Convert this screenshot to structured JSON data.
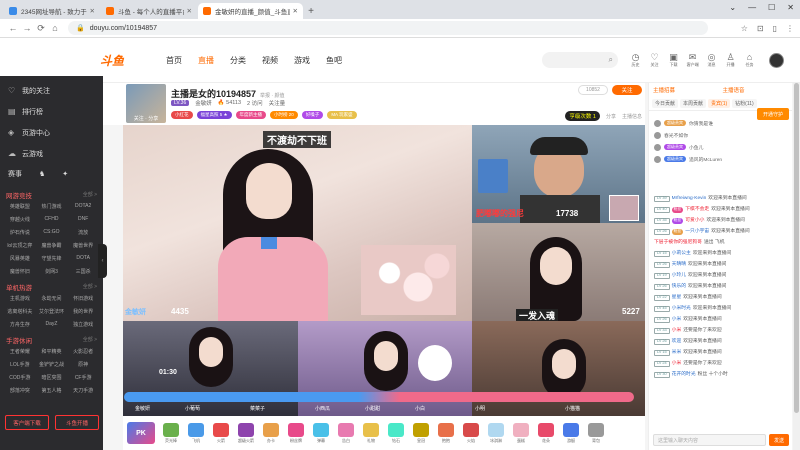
{
  "browser": {
    "tabs": [
      {
        "title": "2345网址导航 - 致力于打造百年品牌",
        "color": "#3a8be8"
      },
      {
        "title": "斗鱼 - 每个人的直播平台",
        "color": "#ff6a00"
      },
      {
        "title": "金敏妍的直播_颜值_斗鱼直播",
        "color": "#ff6a00"
      }
    ],
    "url": "douyu.com/10194857",
    "nav_back": "←",
    "nav_forward": "→",
    "nav_reload": "⟳",
    "nav_home": "⌂",
    "new_tab": "+",
    "window_controls": [
      "⌄",
      "—",
      "☐",
      "✕"
    ],
    "right_icons": [
      "☆",
      "⊡",
      "▯",
      "⋮"
    ]
  },
  "topnav": {
    "logo": "斗鱼",
    "items": [
      "首页",
      "直播",
      "分类",
      "视频",
      "游戏",
      "鱼吧"
    ],
    "active": "直播",
    "search_icon": "⌕",
    "icons": [
      {
        "glyph": "◷",
        "label": "历史"
      },
      {
        "glyph": "♡",
        "label": "关注"
      },
      {
        "glyph": "▣",
        "label": "下载"
      },
      {
        "glyph": "✉",
        "label": "客户端"
      },
      {
        "glyph": "◎",
        "label": "消息"
      },
      {
        "glyph": "♙",
        "label": "开播"
      },
      {
        "glyph": "⌂",
        "label": "任务"
      }
    ]
  },
  "sidebar": {
    "items": [
      {
        "icon": "♡",
        "label": "我的关注"
      },
      {
        "icon": "▤",
        "label": "排行榜"
      },
      {
        "icon": "◈",
        "label": "页游中心"
      },
      {
        "icon": "☁",
        "label": "云游戏"
      }
    ],
    "row3": [
      "赛事",
      "",
      ""
    ],
    "sections": [
      {
        "title": "网游竞技",
        "more": "全部 >",
        "games": [
          "英雄联盟",
          "热门游戏",
          "DOTA2",
          "穿越火线",
          "CFHD",
          "DNF",
          "炉石传说",
          "CS:GO",
          "流放",
          "lol云顶之弈",
          "魔兽争霸",
          "魔兽世界",
          "风暴英雄",
          "守望先锋",
          "DOTA",
          "魔兽怀旧",
          "剑网3",
          "三国杀"
        ]
      },
      {
        "title": "单机热游",
        "more": "全部 >",
        "games": [
          "主机游戏",
          "永劫无间",
          "怀旧游戏",
          "逃离塔科夫",
          "艾尔登法环",
          "我的世界",
          "方舟生存",
          "DayZ",
          "独立游戏"
        ]
      },
      {
        "title": "手游休闲",
        "more": "全部 >",
        "games": [
          "王者荣耀",
          "和平精英",
          "火影忍者",
          "LOL手游",
          "金铲铲之战",
          "原神",
          "COD手游",
          "暗区突围",
          "CF手游",
          "部落冲突",
          "第五人格",
          "天刀手游"
        ]
      }
    ],
    "bottom": [
      "客户端下载",
      "斗鱼开播"
    ],
    "collapse": "‹"
  },
  "room": {
    "avatar_caption": "关注 · 分享",
    "title": "主播是女的10194857",
    "title_note": "举报 · 颜值",
    "level": "LV.36",
    "anchor": "金敏妍",
    "meta": [
      "🔥 54113",
      "2 访问",
      "关注量"
    ],
    "tags": [
      {
        "label": "小红花",
        "color": "#e84a4a"
      },
      {
        "label": "福星高照 5 ★",
        "color": "#7a42d8"
      },
      {
        "label": "年度新主播",
        "color": "#e84a8a"
      },
      {
        "label": "小时榜 20",
        "color": "#ff8a00"
      },
      {
        "label": "好嗓子",
        "color": "#b04ae8"
      },
      {
        "label": "MA 玩家盛",
        "color": "#e8c04a"
      }
    ],
    "report": "10852",
    "follow": "关注",
    "hot": "亨级次数 1",
    "share": "分享",
    "guard": "主播信息"
  },
  "video": {
    "banner": "不渡劫不下班",
    "score_left": "4435",
    "score_right_a": "17738",
    "score_right_b": "5227",
    "caption_b": "一发入魂",
    "nick_left": "金敏妍",
    "nick_right": "肥嘟嘟的强尼",
    "timer": "01:30",
    "bottom_names": [
      "金敏妍",
      "小葡萄",
      "菜菜子",
      "小西瓜",
      "小甜甜",
      "小白",
      "小明",
      "小猫猫"
    ]
  },
  "gifts": {
    "pk": "PK",
    "items": [
      {
        "label": "荧光棒",
        "color": "#6ab04c"
      },
      {
        "label": "飞机",
        "color": "#4a9ae8"
      },
      {
        "label": "火箭",
        "color": "#e84a4a"
      },
      {
        "label": "超级火箭",
        "color": "#8e44ad"
      },
      {
        "label": "办卡",
        "color": "#e8a04a"
      },
      {
        "label": "粉丝牌",
        "color": "#e84a8a"
      },
      {
        "label": "弹幕",
        "color": "#4ac0e8"
      },
      {
        "label": "告白",
        "color": "#e87ab0"
      },
      {
        "label": "礼物",
        "color": "#e8c04a"
      },
      {
        "label": "钻石",
        "color": "#4ae8c8"
      },
      {
        "label": "皇冠",
        "color": "#c0a000"
      },
      {
        "label": "抱抱",
        "color": "#e8704a"
      },
      {
        "label": "火焰",
        "color": "#d84a4a"
      },
      {
        "label": "冰淇淋",
        "color": "#b0d8f0"
      },
      {
        "label": "蛋糕",
        "color": "#f0b0c0"
      },
      {
        "label": "花朵",
        "color": "#e84a6a"
      },
      {
        "label": "游艇",
        "color": "#4a7ae8"
      },
      {
        "label": "背包",
        "color": "#999999"
      }
    ]
  },
  "rightpanel": {
    "top": [
      "主播招募",
      "主播语音"
    ],
    "tabs": [
      "今日贡献",
      "本周贡献",
      "贵宾(1)",
      "钻粉(11)"
    ],
    "active_tab": "贵宾(1)",
    "open_guard": "开通守护",
    "ranks": [
      {
        "badge": "超级贵宾",
        "color": "#e8a04a",
        "name": "你猜我是谁"
      },
      {
        "badge": "",
        "color": "#e84a4a",
        "name": "春光不如你"
      },
      {
        "badge": "超级贵宾",
        "color": "#b04ae8",
        "name": "小鱼儿"
      },
      {
        "badge": "超级贵宾",
        "color": "#4a7ae8",
        "name": "追风的McLuren"
      }
    ],
    "chat": [
      {
        "lv": "LV 39",
        "badge": "",
        "badge_color": "#e8a04a",
        "name": "Mrfreiwng·Kevin",
        "red": false,
        "text": "欢迎来到本直播间"
      },
      {
        "lv": "LV 40",
        "badge": "粉丝",
        "badge_color": "#e84a8a",
        "name": "下棋不会走",
        "red": true,
        "text": "欢迎来到本直播间"
      },
      {
        "lv": "LV 35",
        "badge": "粉丝",
        "badge_color": "#b04ae8",
        "name": "可爱小小",
        "red": true,
        "text": "欢迎来到本直播间"
      },
      {
        "lv": "LV 26",
        "badge": "粉丝",
        "badge_color": "#e8a04a",
        "name": "一只小宇宙",
        "red": false,
        "text": "欢迎来到本直播间"
      },
      {
        "lv": "",
        "badge": "",
        "badge_color": "#e84a4a",
        "name": "下层于被你的强尼狗哥",
        "red": true,
        "text": "送出 飞机"
      },
      {
        "lv": "LV 15",
        "badge": "",
        "badge_color": "#e8a04a",
        "name": "小莉公主",
        "red": false,
        "text": "欢迎来到本直播间"
      },
      {
        "lv": "LV 26",
        "badge": "",
        "badge_color": "#e8a04a",
        "name": "天晴晴",
        "red": false,
        "text": "欢迎来到本直播间"
      },
      {
        "lv": "LV 19",
        "badge": "",
        "badge_color": "#e8a04a",
        "name": "小玲儿",
        "red": false,
        "text": "欢迎来到本直播间"
      },
      {
        "lv": "LV 26",
        "badge": "",
        "badge_color": "#e8a04a",
        "name": "快乐的",
        "red": false,
        "text": "欢迎来到本直播间"
      },
      {
        "lv": "LV 22",
        "badge": "",
        "badge_color": "#e8a04a",
        "name": "星星",
        "red": false,
        "text": "欢迎来到本直播间"
      },
      {
        "lv": "LV 45",
        "badge": "",
        "badge_color": "#4a9ae8",
        "name": "小米时光",
        "red": false,
        "text": "欢迎来到本直播间"
      },
      {
        "lv": "LV 26",
        "badge": "",
        "badge_color": "#e8a04a",
        "name": "小米",
        "red": false,
        "text": "欢迎来到本直播间"
      },
      {
        "lv": "LV 33",
        "badge": "",
        "badge_color": "#e84a4a",
        "name": "小米",
        "red": true,
        "text": "还要是你了来欢迎"
      },
      {
        "lv": "LV 26",
        "badge": "",
        "badge_color": "#e8a04a",
        "name": "欢迎",
        "red": false,
        "text": "欢迎来到本直播间"
      },
      {
        "lv": "LV 15",
        "badge": "",
        "badge_color": "#e8a04a",
        "name": "米米",
        "red": false,
        "text": "欢迎来到本直播间"
      },
      {
        "lv": "LV 24",
        "badge": "",
        "badge_color": "#e84a4a",
        "name": "小米",
        "red": true,
        "text": "还要是你了来欢迎"
      },
      {
        "lv": "LV 30",
        "badge": "",
        "badge_color": "#e8a04a",
        "name": "花开的时光",
        "red": false,
        "text": "粉丝 十个小时"
      }
    ],
    "chat_placeholder": "这里输入聊天内容",
    "send": "发送"
  }
}
